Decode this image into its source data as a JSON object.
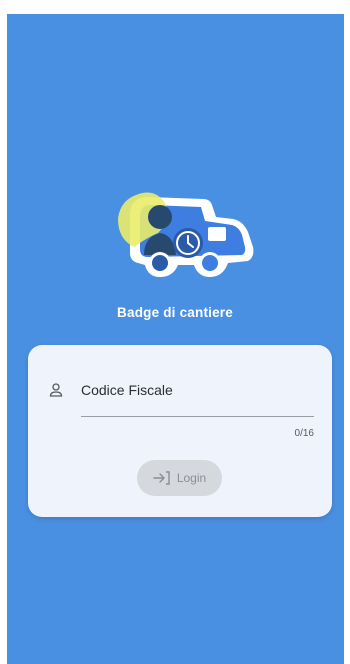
{
  "app": {
    "title": "Badge di cantiere"
  },
  "login_form": {
    "field_label": "Codice Fiscale",
    "field_value": "",
    "char_counter": "0/16",
    "login_label": "Login"
  },
  "icons": {
    "logo": "badge-truck-logo",
    "user": "person-outline-icon",
    "login": "login-arrow-icon"
  },
  "colors": {
    "background": "#4a90e2",
    "card": "#eef3fc",
    "button_disabled": "#d5d8dd"
  }
}
